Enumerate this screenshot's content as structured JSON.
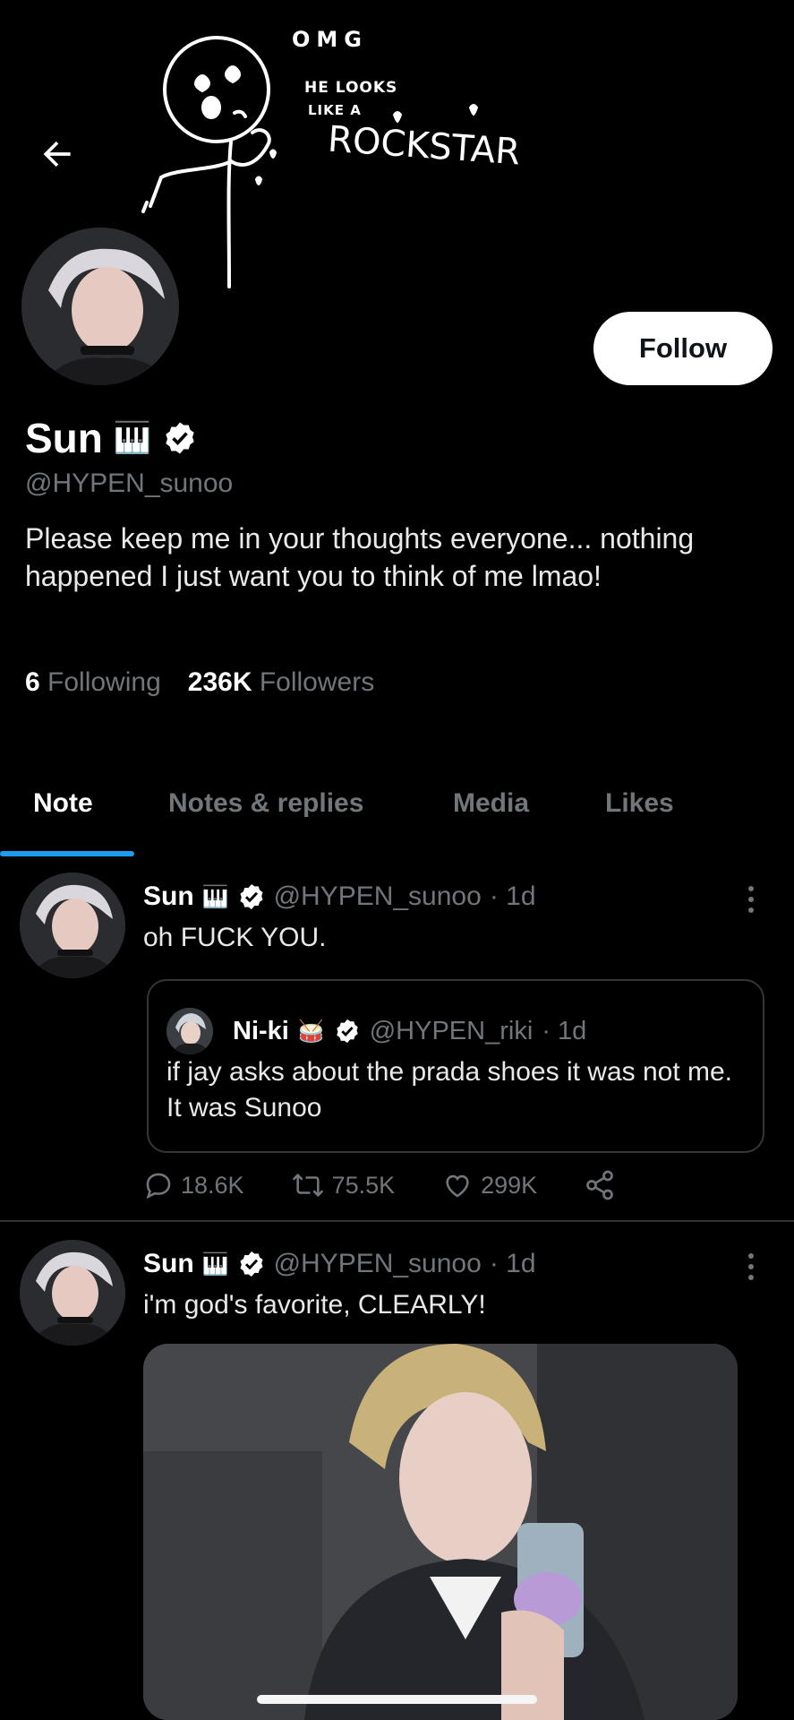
{
  "banner": {
    "doodle_omg": "OMG",
    "doodle_line1": "HE LOOKS",
    "doodle_line2": "LIKE A",
    "doodle_line3": "ROCKSTAR"
  },
  "nav": {
    "back_icon": "arrow-left-icon"
  },
  "profile": {
    "name": "Sun",
    "emoji": "🎹",
    "handle": "@HYPEN_sunoo",
    "follow_label": "Follow",
    "bio": "Please keep me in your thoughts everyone... nothing happened I just want you to think of me lmao!",
    "following_count": "6",
    "following_label": "Following",
    "followers_count": "236K",
    "followers_label": "Followers"
  },
  "tabs": [
    {
      "label": "Note",
      "active": true
    },
    {
      "label": "Notes & replies",
      "active": false
    },
    {
      "label": "Media",
      "active": false
    },
    {
      "label": "Likes",
      "active": false
    }
  ],
  "posts": [
    {
      "name": "Sun",
      "emoji": "🎹",
      "handle": "@HYPEN_sunoo",
      "time": "· 1d",
      "text": "oh FUCK YOU.",
      "quote": {
        "name": "Ni-ki",
        "emoji": "🥁",
        "handle": "@HYPEN_riki",
        "time": "· 1d",
        "text": "if jay asks about the prada shoes it was not me. It was Sunoo"
      },
      "replies": "18.6K",
      "reposts": "75.5K",
      "likes": "299K"
    },
    {
      "name": "Sun",
      "emoji": "🎹",
      "handle": "@HYPEN_sunoo",
      "time": "· 1d",
      "text": "i'm god's favorite, CLEARLY!"
    }
  ],
  "colors": {
    "background": "#000000",
    "accent": "#1d9bf0",
    "secondary_text": "#71767b",
    "verified_badge": "#ffffff"
  }
}
